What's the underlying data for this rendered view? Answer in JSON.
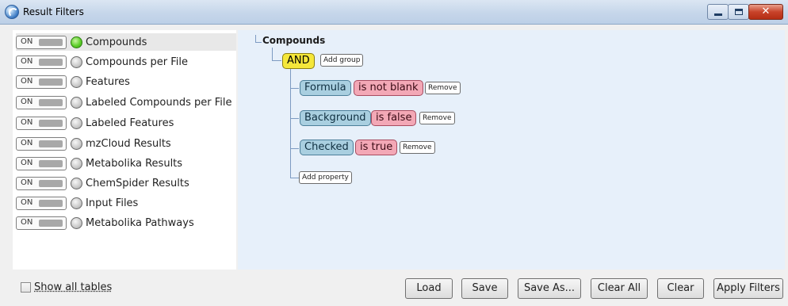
{
  "window": {
    "title": "Result Filters",
    "controls": [
      "minimize",
      "maximize",
      "close"
    ]
  },
  "left_panel": {
    "toggle_label": "ON",
    "items": [
      {
        "label": "Compounds",
        "active": true
      },
      {
        "label": "Compounds per File",
        "active": false
      },
      {
        "label": "Features",
        "active": false
      },
      {
        "label": "Labeled Compounds per File",
        "active": false
      },
      {
        "label": "Labeled Features",
        "active": false
      },
      {
        "label": "mzCloud Results",
        "active": false
      },
      {
        "label": "Metabolika Results",
        "active": false
      },
      {
        "label": "ChemSpider Results",
        "active": false
      },
      {
        "label": "Input Files",
        "active": false
      },
      {
        "label": "Metabolika Pathways",
        "active": false
      }
    ]
  },
  "filter_tree": {
    "root": "Compounds",
    "operator": "AND",
    "add_group_label": "Add group",
    "conditions": [
      {
        "property": "Formula",
        "condition": "is not blank",
        "remove_label": "Remove"
      },
      {
        "property": "Background",
        "condition": "is false",
        "remove_label": "Remove"
      },
      {
        "property": "Checked",
        "condition": "is true",
        "remove_label": "Remove"
      }
    ],
    "add_property_label": "Add property"
  },
  "bottom": {
    "show_all_label": "Show all tables",
    "show_all_checked": false,
    "buttons": {
      "load": "Load",
      "save": "Save",
      "save_as": "Save As...",
      "clear_all": "Clear All",
      "clear": "Clear",
      "apply": "Apply Filters"
    }
  },
  "colors": {
    "and_chip": "#f5e73a",
    "property_chip": "#a9cfe0",
    "condition_chip": "#f3a8b6",
    "active_status": "#5fcf2c",
    "tree_background": "#e7f0fa"
  }
}
